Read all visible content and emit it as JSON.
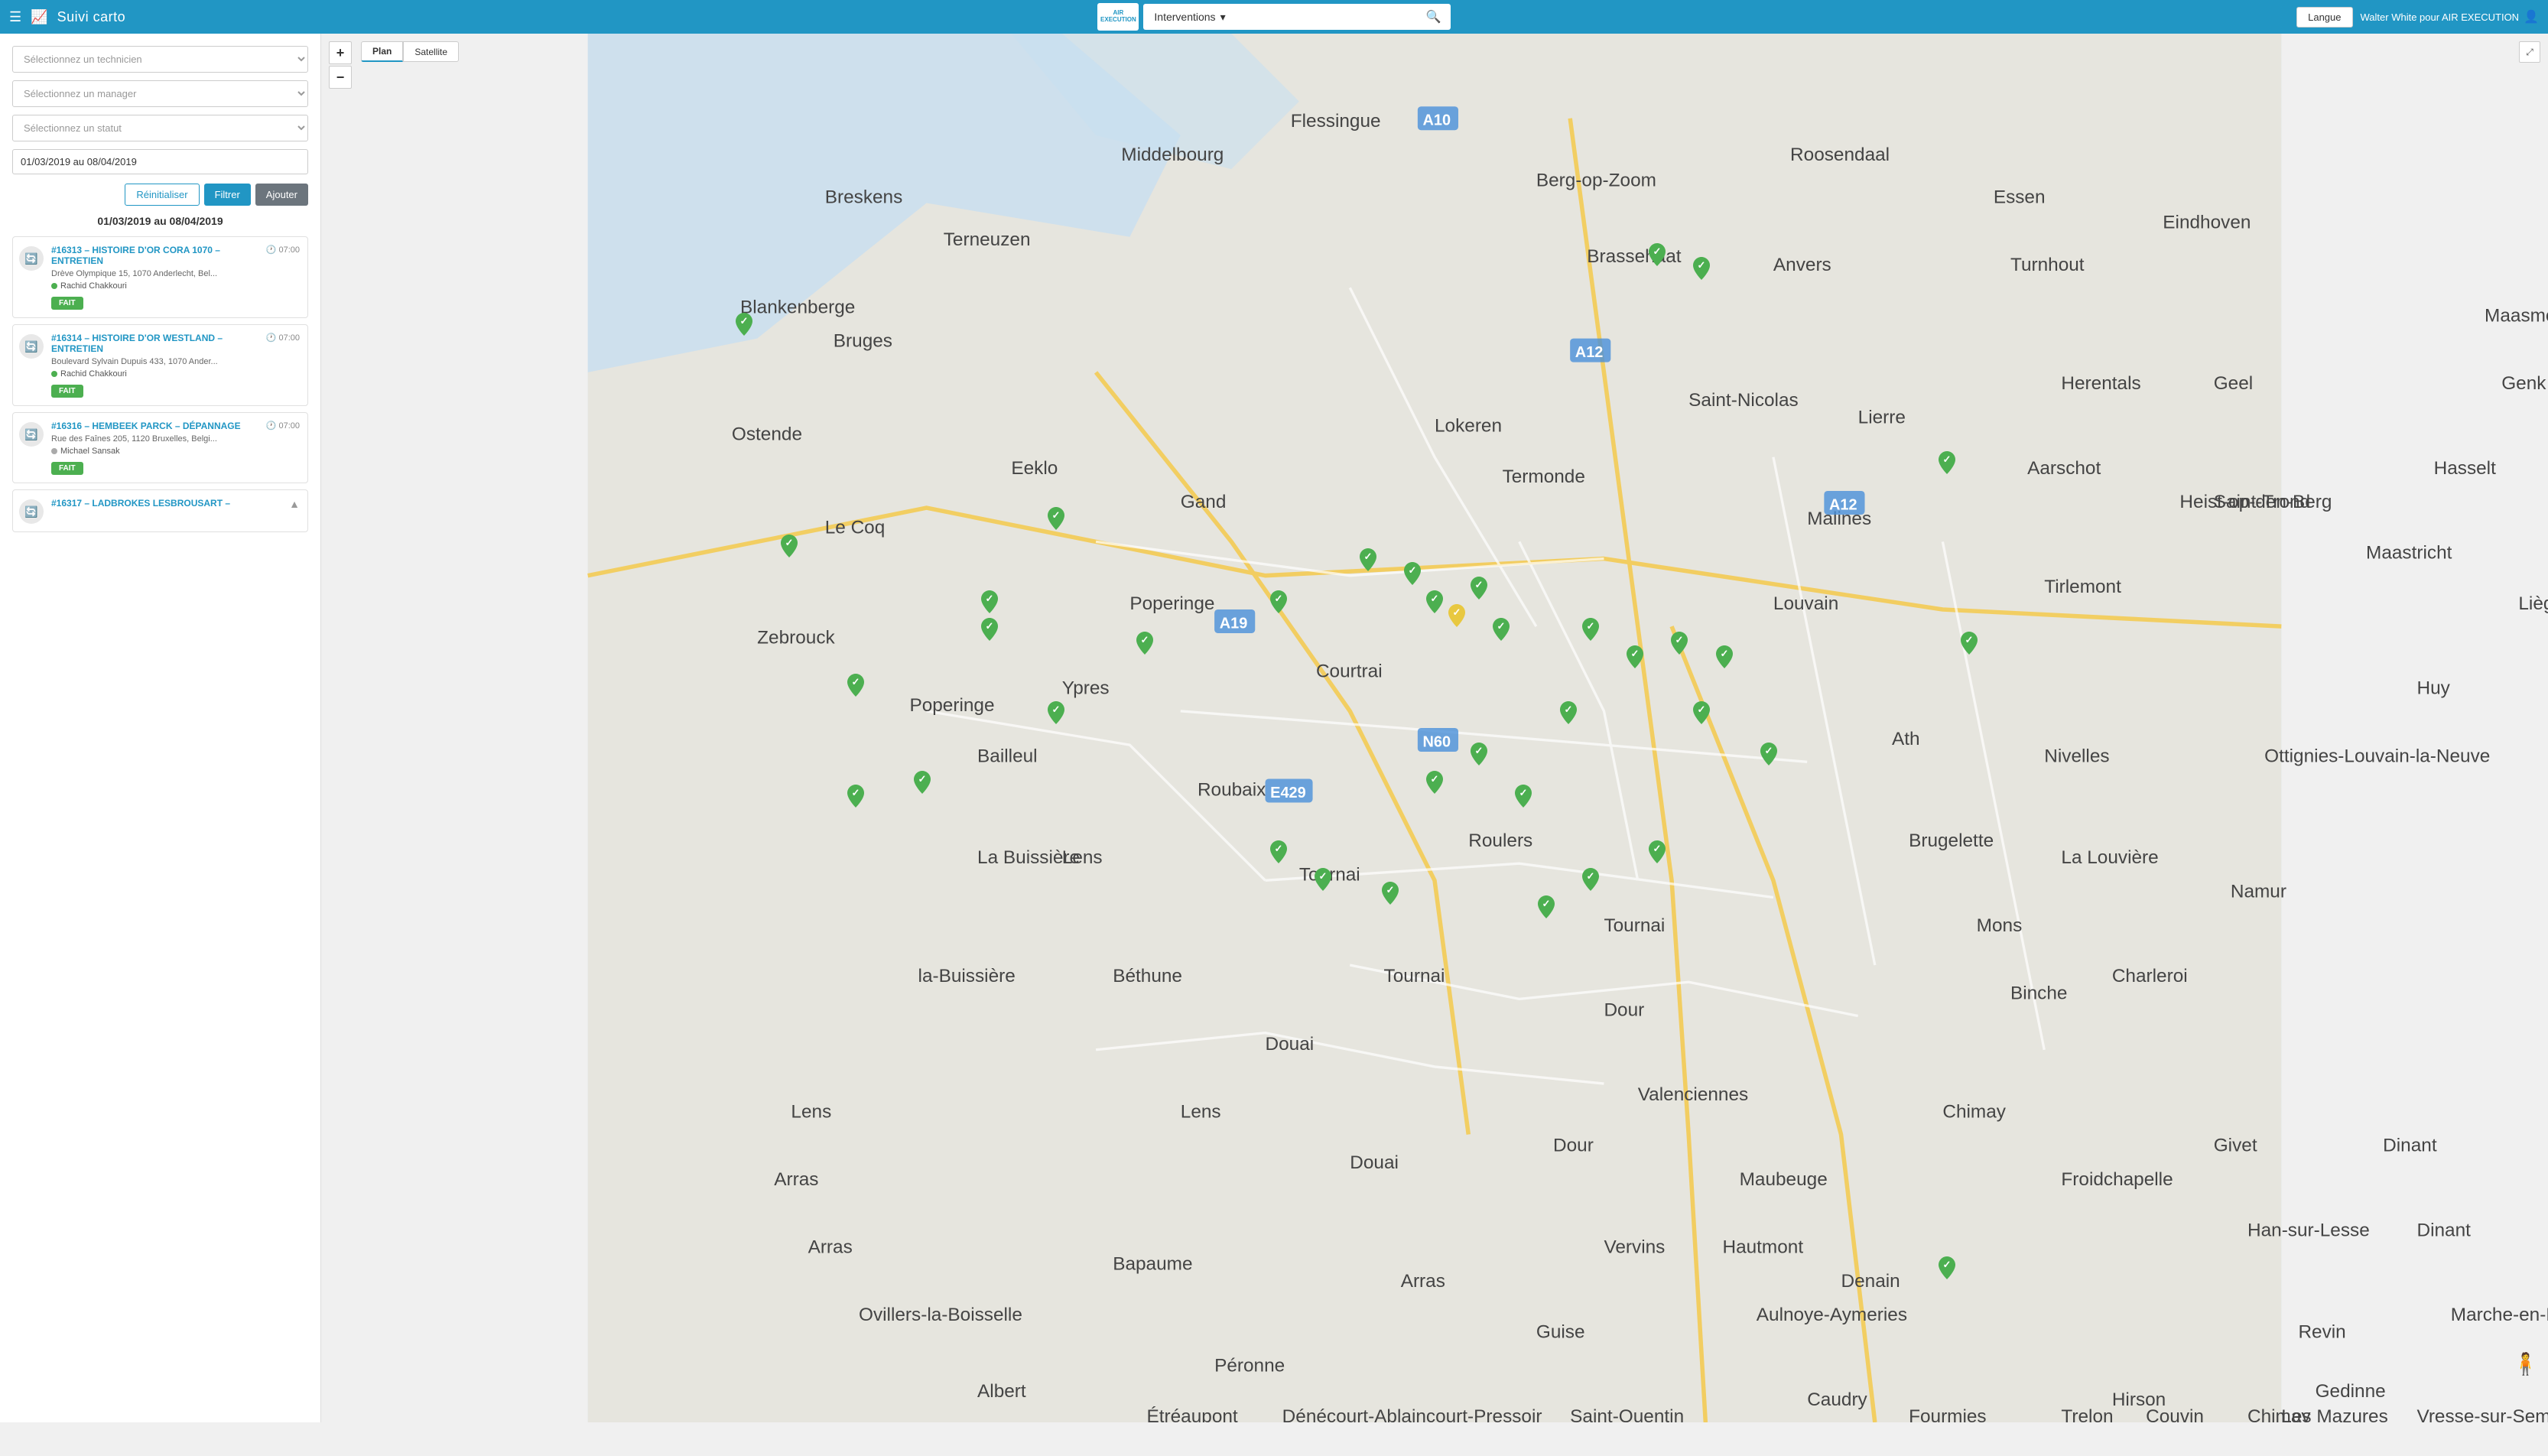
{
  "topnav": {
    "app_title": "Suivi carto",
    "logo_line1": "AIR",
    "logo_line2": "EXECUTION",
    "interventions_label": "Interventions",
    "search_placeholder": "",
    "langue_label": "Langue",
    "user_label": "Walter White pour AIR EXECUTION"
  },
  "sidebar": {
    "select_technician_placeholder": "Sélectionnez un technicien",
    "select_manager_placeholder": "Sélectionnez un manager",
    "select_statut_placeholder": "Sélectionnez un statut",
    "date_input_value": "01/03/2019 au 08/04/2019",
    "btn_reinit": "Réinitialiser",
    "btn_filter": "Filtrer",
    "btn_add": "Ajouter",
    "date_range_label": "01/03/2019 au 08/04/2019",
    "interventions": [
      {
        "id": "card-1",
        "title": "#16313 – HISTOIRE D'OR CORA 1070 – ENTRETIEN",
        "time": "07:00",
        "address": "Drève Olympique 15, 1070 Anderlecht, Bel...",
        "technician": "Rachid Chakkouri",
        "tech_dot": "green",
        "status": "FAIT"
      },
      {
        "id": "card-2",
        "title": "#16314 – HISTOIRE D'OR WESTLAND – ENTRETIEN",
        "time": "07:00",
        "address": "Boulevard Sylvain Dupuis 433, 1070 Ander...",
        "technician": "Rachid Chakkouri",
        "tech_dot": "green",
        "status": "FAIT"
      },
      {
        "id": "card-3",
        "title": "#16316 – HEMBEEK PARCK – DÉPANNAGE",
        "time": "07:00",
        "address": "Rue des Faînes 205, 1120 Bruxelles, Belgi...",
        "technician": "Michael Sansak",
        "tech_dot": "gray",
        "status": "FAIT"
      },
      {
        "id": "card-4",
        "title": "#16317 – LADBROKES LESBROUSART –",
        "time": "",
        "address": "",
        "technician": "",
        "tech_dot": "",
        "status": ""
      }
    ]
  },
  "map": {
    "plan_label": "Plan",
    "satellite_label": "Satellite",
    "zoom_in": "+",
    "zoom_out": "−"
  },
  "icons": {
    "hamburger": "☰",
    "chart": "📈",
    "search": "🔍",
    "user": "👤",
    "clock": "🕐",
    "sync": "🔄",
    "chevron_down": "▾",
    "expand": "⤢",
    "pegman": "🧍"
  }
}
